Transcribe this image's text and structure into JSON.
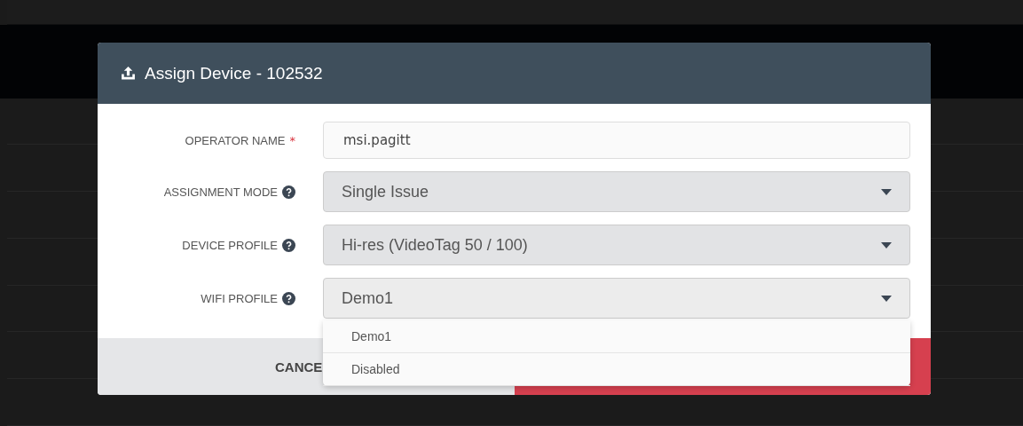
{
  "dialog": {
    "title": "Assign Device - 102532",
    "fields": [
      {
        "kind": "text",
        "label": "OPERATOR NAME",
        "required_mark": "*",
        "help": false,
        "value": "msi.pagitt"
      },
      {
        "kind": "select",
        "label": "ASSIGNMENT MODE",
        "help": true,
        "value": "Single Issue"
      },
      {
        "kind": "select",
        "label": "DEVICE PROFILE",
        "help": true,
        "value": "Hi-res (VideoTag 50 / 100)"
      },
      {
        "kind": "select",
        "label": "WIFI PROFILE",
        "help": true,
        "value": "Demo1",
        "options": [
          "Demo1",
          "Disabled"
        ]
      }
    ],
    "buttons": [
      {
        "kind": "cancel",
        "label": "CANCE"
      },
      {
        "kind": "confirm"
      }
    ]
  }
}
